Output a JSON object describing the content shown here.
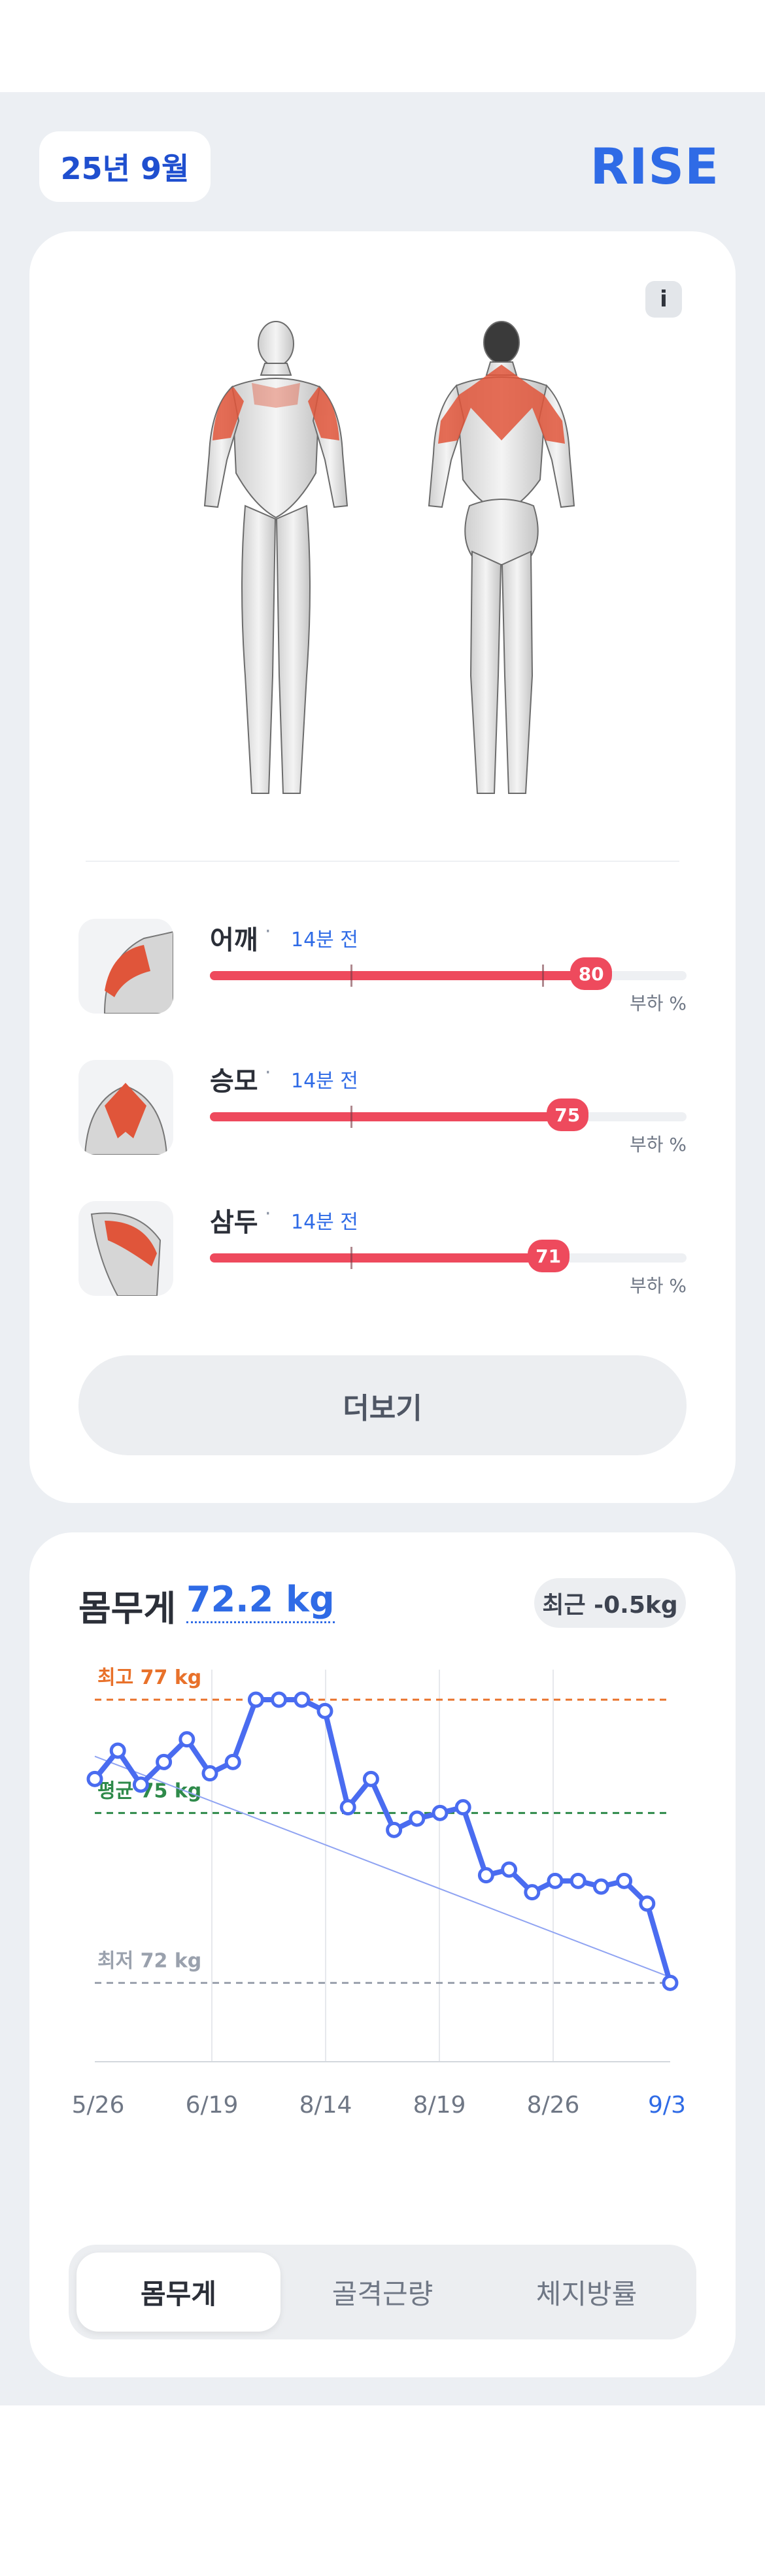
{
  "header": {
    "month": "25년 9월",
    "brand": "RISE"
  },
  "muscle_card": {
    "info_label": "i",
    "muscles": [
      {
        "name": "어깨",
        "time": "14분 전",
        "load": 80,
        "unit": "부하 %"
      },
      {
        "name": "승모",
        "time": "14분 전",
        "load": 75,
        "unit": "부하 %"
      },
      {
        "name": "삼두",
        "time": "14분 전",
        "load": 71,
        "unit": "부하 %"
      }
    ],
    "separator": "·",
    "more_label": "더보기"
  },
  "weight_card": {
    "title": "몸무게",
    "value": "72.2 kg",
    "recent": "최근 -0.5kg",
    "tabs": [
      {
        "label": "몸무게",
        "active": true
      },
      {
        "label": "골격근량",
        "active": false
      },
      {
        "label": "체지방률",
        "active": false
      }
    ]
  },
  "chart_data": {
    "type": "line",
    "x_tick_labels": [
      "5/26",
      "6/19",
      "8/14",
      "8/19",
      "8/26",
      "9/3"
    ],
    "reference_lines": [
      {
        "label": "최고 77 kg",
        "value": 77,
        "color": "#e8712a"
      },
      {
        "label": "평균 75 kg",
        "value": 75,
        "color": "#2e8a4a"
      },
      {
        "label": "최저 72 kg",
        "value": 72,
        "color": "#9aa1ad"
      }
    ],
    "ylim": [
      71.3,
      77.3
    ],
    "series": [
      {
        "values": [
          75.6,
          76.1,
          75.5,
          75.9,
          76.3,
          75.7,
          75.9,
          77.0,
          77.0,
          77.0,
          76.8,
          75.1,
          75.6,
          74.7,
          74.9,
          75.0,
          75.1,
          73.9,
          74.0,
          73.6,
          73.8,
          73.8,
          73.7,
          73.8,
          73.4,
          72.0
        ],
        "color": "#4a6cf0"
      }
    ],
    "trendline": {
      "from": 76.0,
      "to": 72.1,
      "color": "#8fa3f2"
    },
    "grid": "vertical",
    "highlight_last_tick_color": "#2f6be6"
  }
}
